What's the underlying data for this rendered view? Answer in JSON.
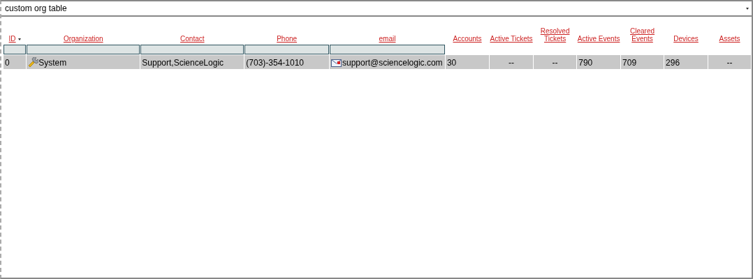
{
  "selector": {
    "value": "custom org table"
  },
  "table": {
    "columns": [
      {
        "label": "ID",
        "sorted": true,
        "filter": true
      },
      {
        "label": "Organization",
        "sorted": false,
        "filter": true
      },
      {
        "label": "Contact",
        "sorted": false,
        "filter": true
      },
      {
        "label": "Phone",
        "sorted": false,
        "filter": true
      },
      {
        "label": "email",
        "sorted": false,
        "filter": true
      },
      {
        "label": "Accounts",
        "sorted": false,
        "filter": false
      },
      {
        "label": "Active Tickets",
        "sorted": false,
        "filter": false
      },
      {
        "label": "Resolved Tickets",
        "sorted": false,
        "filter": false
      },
      {
        "label": "Active Events",
        "sorted": false,
        "filter": false
      },
      {
        "label": "Cleared Events",
        "sorted": false,
        "filter": false
      },
      {
        "label": "Devices",
        "sorted": false,
        "filter": false
      },
      {
        "label": "Assets",
        "sorted": false,
        "filter": false
      }
    ],
    "rows": [
      {
        "selected": true,
        "cells": [
          {
            "kind": "text",
            "text": "0"
          },
          {
            "kind": "org",
            "text": "System"
          },
          {
            "kind": "text",
            "text": "Support,ScienceLogic"
          },
          {
            "kind": "text",
            "text": "(703)-354-1010"
          },
          {
            "kind": "email",
            "text": "support@sciencelogic.com"
          },
          {
            "kind": "text",
            "text": "30"
          },
          {
            "kind": "empty",
            "text": "--"
          },
          {
            "kind": "empty",
            "text": "--"
          },
          {
            "kind": "text",
            "text": "790"
          },
          {
            "kind": "text",
            "text": "709"
          },
          {
            "kind": "text",
            "text": "296"
          },
          {
            "kind": "empty",
            "text": "--"
          }
        ]
      }
    ]
  }
}
